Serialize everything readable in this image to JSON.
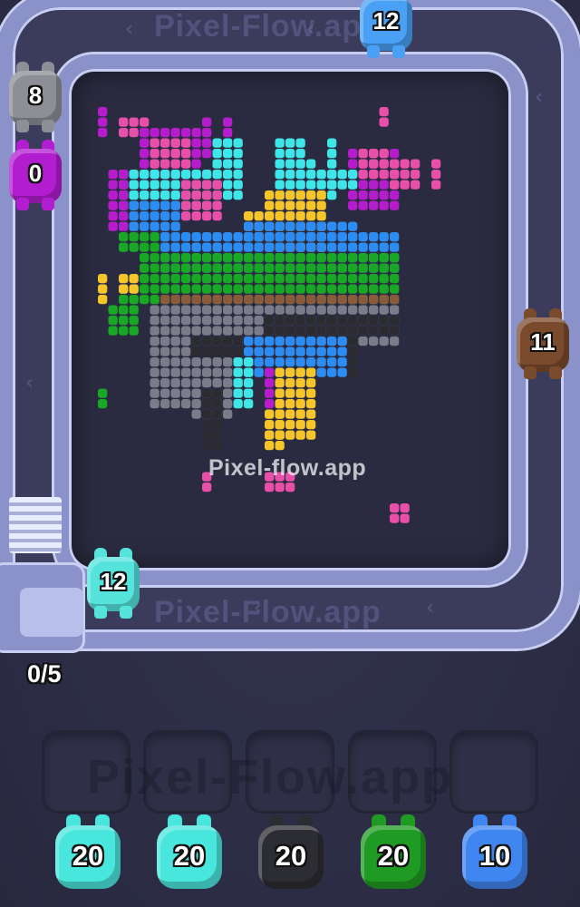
{
  "watermark": "Pixel-flow.app",
  "belt_watermark": "Pixel-Flow.app",
  "tray_watermark": "Pixel-Flow.app",
  "belt_arrow": "‹",
  "progress": "0/5",
  "colors": {
    "cyan": "#3fe6e8",
    "pink": "#e84fa8",
    "magenta": "#b41ccc",
    "blue": "#2c8cf2",
    "yellow": "#f6c52a",
    "green": "#18a826",
    "black": "#2b2b30",
    "gray": "#7b7c8a",
    "brown": "#8a5a3c"
  },
  "belt_pigs": [
    {
      "name": "pig-top",
      "count": "12",
      "color": "#4aa0f5"
    },
    {
      "name": "pig-left-gray",
      "count": "8",
      "color": "#8d8e96"
    },
    {
      "name": "pig-left-purple",
      "count": "0",
      "color": "#b21dd0"
    },
    {
      "name": "pig-right-brown",
      "count": "11",
      "color": "#7a4a2c"
    },
    {
      "name": "pig-dock-cyan",
      "count": "12",
      "color": "#55e3dc"
    }
  ],
  "queue_pigs": [
    {
      "name": "queue-pig-cyan-1",
      "count": "20",
      "color": "#49e6dd"
    },
    {
      "name": "queue-pig-cyan-2",
      "count": "20",
      "color": "#49e6dd"
    },
    {
      "name": "queue-pig-black",
      "count": "20",
      "color": "#2c2c33"
    },
    {
      "name": "queue-pig-green",
      "count": "20",
      "color": "#1f9a22"
    },
    {
      "name": "queue-pig-blue",
      "count": "10",
      "color": "#3f86f0"
    }
  ],
  "tray_slots": [
    "",
    "",
    "",
    "",
    ""
  ]
}
